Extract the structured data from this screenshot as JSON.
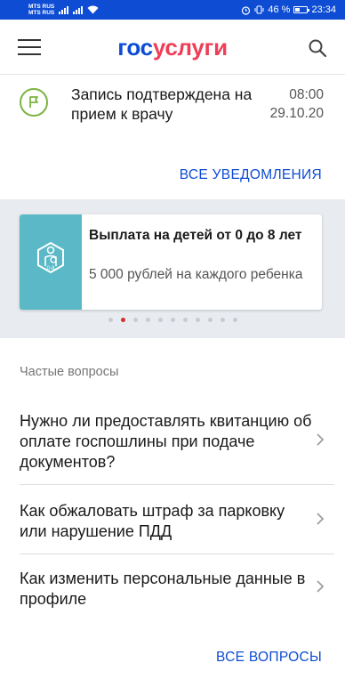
{
  "status_bar": {
    "carrier_1": "MTS RUS",
    "carrier_2": "MTS RUS",
    "battery_text": "46 %",
    "time": "23:34"
  },
  "app_bar": {
    "logo_part_1": "гос",
    "logo_part_2": "услуги",
    "menu_icon": "hamburger-menu-icon",
    "search_icon": "search-icon"
  },
  "notification": {
    "icon": "flag-icon",
    "text": "Запись подтверждена на прием к врачу",
    "time": "08:00",
    "date": "29.10.20"
  },
  "all_notifications_label": "ВСЕ УВЕДОМЛЕНИЯ",
  "banner": {
    "icon": "child-payment-icon",
    "icon_caption": "0-8",
    "title": "Выплата на детей от 0 до 8 лет",
    "description": "5 000 рублей на каждого ребенка",
    "dots_total": 11,
    "active_dot": 1
  },
  "faq": {
    "label": "Частые вопросы",
    "items": [
      {
        "question": "Нужно ли предоставлять квитанцию об оплате госпошлины при подаче документов?"
      },
      {
        "question": "Как обжаловать штраф за парковку или нарушение ПДД"
      },
      {
        "question": "Как изменить персональные данные в профиле"
      }
    ],
    "all_label": "ВСЕ ВОПРОСЫ"
  },
  "colors": {
    "status_bar": "#0d4cd3",
    "brand_blue": "#0d4cd3",
    "brand_red": "#ee3f58",
    "link": "#0d4cd3",
    "banner_tile": "#5bb9c7",
    "active_dot": "#d32f2f",
    "notif_icon": "#7cb342"
  }
}
